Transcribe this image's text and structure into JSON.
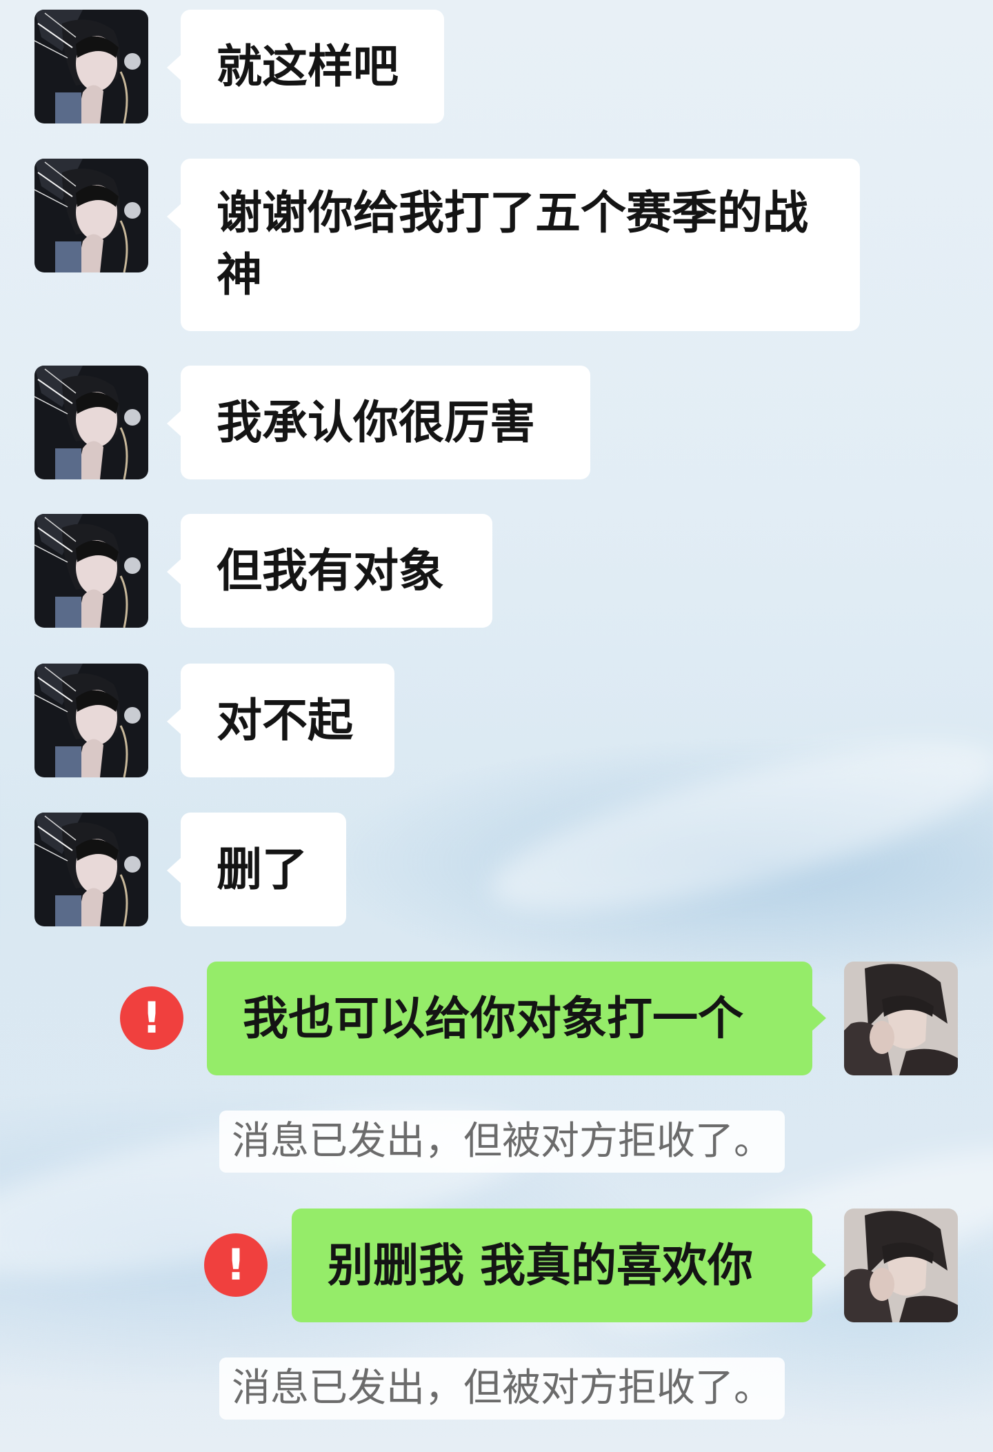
{
  "messages": [
    {
      "side": "incoming",
      "avatar": "woman-avatar",
      "text": "就这样吧"
    },
    {
      "side": "incoming",
      "avatar": "woman-avatar",
      "text": "谢谢你给我打了五个赛季的战神"
    },
    {
      "side": "incoming",
      "avatar": "woman-avatar",
      "text": "我承认你很厉害"
    },
    {
      "side": "incoming",
      "avatar": "woman-avatar",
      "text": "但我有对象"
    },
    {
      "side": "incoming",
      "avatar": "woman-avatar",
      "text": "对不起"
    },
    {
      "side": "incoming",
      "avatar": "woman-avatar",
      "text": "删了"
    },
    {
      "side": "outgoing",
      "avatar": "man-avatar",
      "text": "我也可以给你对象打一个",
      "status_icon": "!",
      "notice": "消息已发出，但被对方拒收了。"
    },
    {
      "side": "outgoing",
      "avatar": "man-avatar",
      "text": "别删我 我真的喜欢你",
      "status_icon": "!",
      "notice": "消息已发出，但被对方拒收了。"
    }
  ],
  "colors": {
    "incoming_bubble": "#ffffff",
    "outgoing_bubble": "#95ec69",
    "error_badge": "#f0403e",
    "notice_text": "#6b6b6b"
  }
}
